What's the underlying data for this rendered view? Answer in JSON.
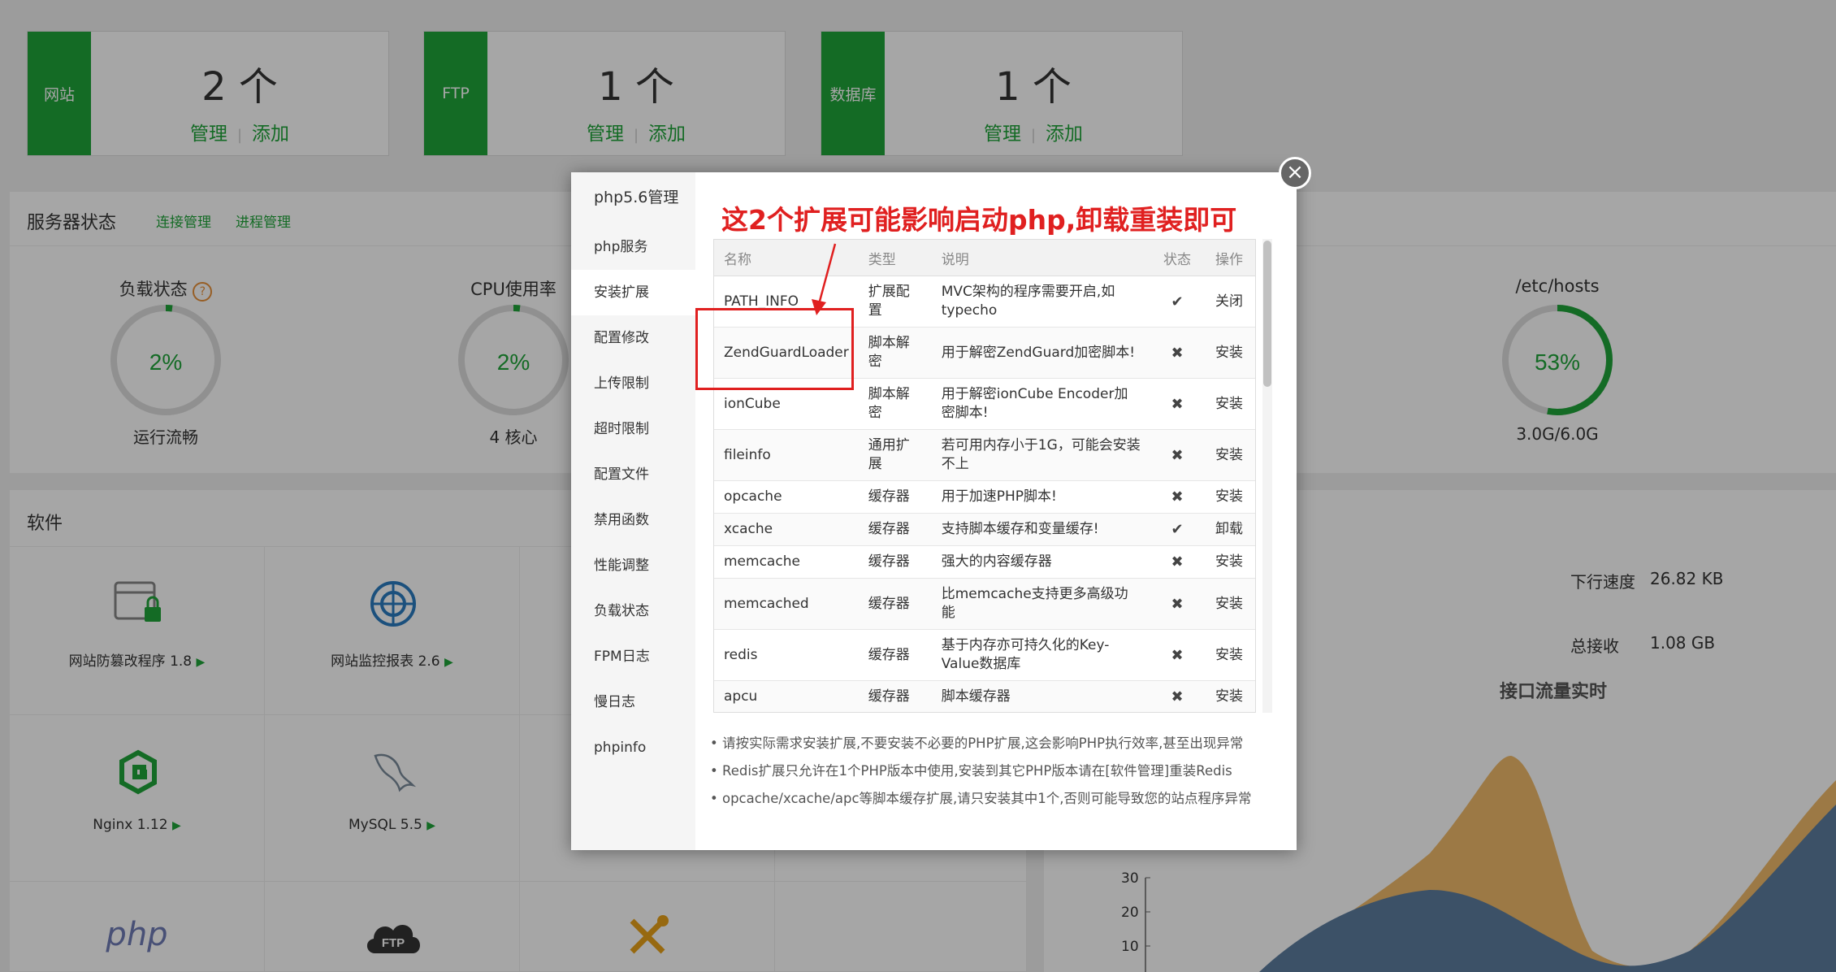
{
  "stats": [
    {
      "label": "网站",
      "count": "2 个",
      "manage": "管理",
      "add": "添加"
    },
    {
      "label": "FTP",
      "count": "1 个",
      "manage": "管理",
      "add": "添加"
    },
    {
      "label": "数据库",
      "count": "1 个",
      "manage": "管理",
      "add": "添加"
    }
  ],
  "server": {
    "title": "服务器状态",
    "conn_link": "连接管理",
    "proc_link": "进程管理",
    "gauges": [
      {
        "title": "负载状态",
        "value": "2%",
        "sub": "运行流畅",
        "level": 0.02,
        "help": "?"
      },
      {
        "title": "CPU使用率",
        "value": "2%",
        "sub": "4 核心",
        "level": 0.02
      },
      {
        "title": "/etc/hosts",
        "value": "53%",
        "sub": "3.0G/6.0G",
        "level": 0.53
      }
    ]
  },
  "software": {
    "title": "软件",
    "items": [
      {
        "label": "网站防篡改程序 1.8",
        "icon": "lock-window-icon"
      },
      {
        "label": "网站监控报表 2.6",
        "icon": "radar-icon"
      },
      {
        "label": "Nginx 1.12",
        "icon": "nginx-icon"
      },
      {
        "label": "MySQL 5.5",
        "icon": "mysql-dolphin-icon"
      },
      {
        "label": "php",
        "icon": "php-logo"
      },
      {
        "label": "FTP",
        "icon": "ftp-cloud-icon"
      },
      {
        "label": "",
        "icon": "tools-icon"
      }
    ]
  },
  "network": {
    "down_speed_label": "下行速度",
    "down_speed": "26.82 KB",
    "total_recv_label": "总接收",
    "total_recv": "1.08 GB",
    "chart_title": "接口流量实时",
    "ticks": [
      "30",
      "20",
      "10"
    ]
  },
  "modal": {
    "title": "php5.6管理",
    "close": "×",
    "menu": [
      "php服务",
      "安装扩展",
      "配置修改",
      "上传限制",
      "超时限制",
      "配置文件",
      "禁用函数",
      "性能调整",
      "负载状态",
      "FPM日志",
      "慢日志",
      "phpinfo"
    ],
    "active_index": 1,
    "headers": {
      "name": "名称",
      "type": "类型",
      "desc": "说明",
      "status": "状态",
      "op": "操作"
    },
    "rows": [
      {
        "name": "PATH_INFO",
        "type": "扩展配置",
        "desc": "MVC架构的程序需要开启,如typecho",
        "status": "✔",
        "op": "关闭",
        "op_kind": "close"
      },
      {
        "name": "ZendGuardLoader",
        "type": "脚本解密",
        "desc": "用于解密ZendGuard加密脚本!",
        "status": "✖",
        "op": "安装",
        "op_kind": "blue"
      },
      {
        "name": "ionCube",
        "type": "脚本解密",
        "desc": "用于解密ionCube Encoder加密脚本!",
        "status": "✖",
        "op": "安装",
        "op_kind": "install"
      },
      {
        "name": "fileinfo",
        "type": "通用扩展",
        "desc": "若可用内存小于1G，可能会安装不上",
        "status": "✖",
        "op": "安装",
        "op_kind": "install"
      },
      {
        "name": "opcache",
        "type": "缓存器",
        "desc": "用于加速PHP脚本!",
        "status": "✖",
        "op": "安装",
        "op_kind": "install"
      },
      {
        "name": "xcache",
        "type": "缓存器",
        "desc": "支持脚本缓存和变量缓存!",
        "status": "✔",
        "op": "卸载",
        "op_kind": "uninstall"
      },
      {
        "name": "memcache",
        "type": "缓存器",
        "desc": "强大的内容缓存器",
        "status": "✖",
        "op": "安装",
        "op_kind": "install"
      },
      {
        "name": "memcached",
        "type": "缓存器",
        "desc": "比memcache支持更多高级功能",
        "status": "✖",
        "op": "安装",
        "op_kind": "install"
      },
      {
        "name": "redis",
        "type": "缓存器",
        "desc": "基于内存亦可持久化的Key-Value数据库",
        "status": "✖",
        "op": "安装",
        "op_kind": "install"
      },
      {
        "name": "apcu",
        "type": "缓存器",
        "desc": "脚本缓存器",
        "status": "✖",
        "op": "安装",
        "op_kind": "install"
      }
    ],
    "notes": [
      "请按实际需求安装扩展,不要安装不必要的PHP扩展,这会影响PHP执行效率,甚至出现异常",
      "Redis扩展只允许在1个PHP版本中使用,安装到其它PHP版本请在[软件管理]重装Redis",
      "opcache/xcache/apc等脚本缓存扩展,请只安装其中1个,否则可能导致您的站点程序异常"
    ]
  },
  "annotation": "这2个扩展可能影响启动php,卸载重装即可"
}
